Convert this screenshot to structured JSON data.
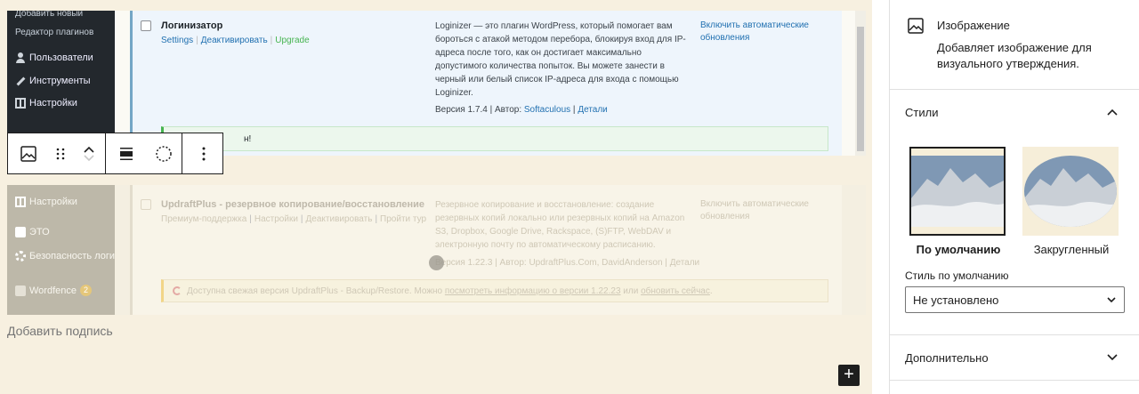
{
  "screenshot_top": {
    "sidebar": {
      "items": [
        {
          "label": "Добавить новый"
        },
        {
          "label": "Редактор плагинов"
        },
        {
          "label": "Пользователи"
        },
        {
          "label": "Инструменты"
        },
        {
          "label": "Настройки"
        }
      ]
    },
    "plugin": {
      "name": "Логинизатор",
      "actions": [
        "Settings",
        "Деактивировать",
        "Upgrade"
      ],
      "description": "Loginizer — это плагин WordPress, который помогает вам бороться с атакой методом перебора, блокируя вход для IP-адреса после того, как он достигает максимально допустимого количества попыток. Вы можете занести в черный или белый список IP-адреса для входа с помощью Loginizer.",
      "meta_version": "Версия 1.7.4 | Автор:",
      "meta_author": "Softaculous",
      "meta_details": "Детали",
      "auto_updates": "Включить автоматические обновления",
      "notice_tail": "н!"
    }
  },
  "screenshot_bottom": {
    "sidebar": {
      "items": [
        {
          "label": "Настройки"
        },
        {
          "label": "ЭТО"
        },
        {
          "label": "Безопасность логина"
        },
        {
          "label": "Wordfence"
        }
      ],
      "wordfence_badge": "2"
    },
    "plugin": {
      "name": "UpdraftPlus - резервное копирование/восстановление",
      "actions": [
        "Премиум-поддержка",
        "Настройки",
        "Деактивировать",
        "Пройти тур"
      ],
      "description": "Резервное копирование и восстановление: создание резервных копий локально или резервных копий на Amazon S3, Dropbox, Google Drive, Rackspace, (S)FTP, WebDAV и электронную почту по автоматическому расписанию.",
      "meta_version": "Версия 1.22.3 | Автор:",
      "meta_author": "UpdraftPlus.Com, DavidAnderson",
      "meta_details": "Детали",
      "auto_updates": "Включить автоматические обновления",
      "notice_text": "Доступна свежая версия UpdraftPlus - Backup/Restore. Можно",
      "notice_link1": "посмотреть информацию о версии 1.22.23",
      "notice_or": "или",
      "notice_link2": "обновить сейчас",
      "notice_end": "."
    }
  },
  "block_toolbar": {
    "icons": [
      "image-icon",
      "drag-handle-icon",
      "move-up-icon",
      "move-down-icon",
      "align-icon",
      "duotone-icon",
      "more-options-icon"
    ]
  },
  "editor": {
    "caption_placeholder": "Добавить подпись",
    "inserter_label": "+"
  },
  "inspector": {
    "block_title": "Изображение",
    "block_description": "Добавляет изображение для визуального утверждения.",
    "styles_panel_title": "Стили",
    "styles": [
      {
        "label": "По умолчанию",
        "selected": true
      },
      {
        "label": "Закругленный",
        "selected": false
      }
    ],
    "default_style_label": "Стиль по умолчанию",
    "default_style_value": "Не установлено",
    "advanced_panel_title": "Дополнительно"
  },
  "colors": {
    "canvas_bg": "#f7f0e0",
    "wp_admin_dark": "#23282d",
    "link_blue": "#2271b1",
    "text_dark": "#1e1e1e"
  }
}
